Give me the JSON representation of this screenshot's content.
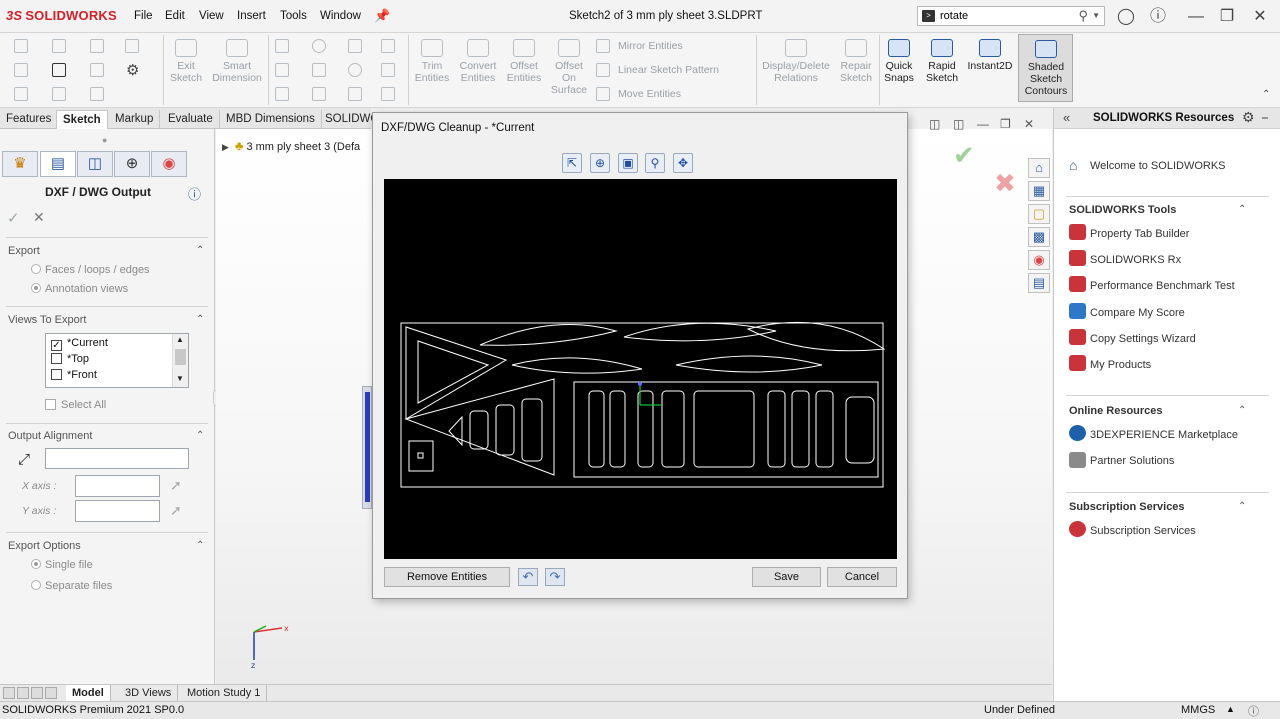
{
  "app": {
    "logo": "SOLIDWORKS",
    "doc_title": "Sketch2 of 3 mm ply sheet 3.SLDPRT"
  },
  "menu": [
    "File",
    "Edit",
    "View",
    "Insert",
    "Tools",
    "Window"
  ],
  "search": {
    "value": "rotate"
  },
  "ribbon": {
    "exit_sketch": "Exit Sketch",
    "smart_dimension": "Smart Dimension",
    "trim_entities": "Trim Entities",
    "convert_entities": "Convert Entities",
    "offset_entities": "Offset Entities",
    "offset_on_surface": "Offset On Surface",
    "mirror_entities": "Mirror Entities",
    "linear_sketch_pattern": "Linear Sketch Pattern",
    "move_entities": "Move Entities",
    "display_delete_relations": "Display/Delete Relations",
    "repair_sketch": "Repair Sketch",
    "quick_snaps": "Quick Snaps",
    "rapid_sketch": "Rapid Sketch",
    "instant2d": "Instant2D",
    "shaded_sketch_contours": "Shaded Sketch Contours"
  },
  "tabs": [
    "Features",
    "Sketch",
    "Markup",
    "Evaluate",
    "MBD Dimensions",
    "SOLIDWO"
  ],
  "tree_item": "3 mm ply sheet 3  (Defa",
  "property_manager": {
    "title": "DXF / DWG Output",
    "export": {
      "heading": "Export",
      "options": [
        "Faces / loops / edges",
        "Annotation views"
      ]
    },
    "views_to_export": {
      "heading": "Views To Export",
      "items": [
        "*Current",
        "*Top",
        "*Front"
      ],
      "select_all": "Select All"
    },
    "output_alignment": {
      "heading": "Output Alignment",
      "x_axis": "X axis :",
      "y_axis": "Y axis :"
    },
    "export_options": {
      "heading": "Export Options",
      "options": [
        "Single file",
        "Separate files"
      ]
    }
  },
  "dialog": {
    "title": "DXF/DWG Cleanup - *Current",
    "remove_entities": "Remove Entities",
    "save": "Save",
    "cancel": "Cancel"
  },
  "resources": {
    "title": "SOLIDWORKS Resources",
    "welcome": "Welcome to SOLIDWORKS",
    "tools_heading": "SOLIDWORKS Tools",
    "tools": [
      "Property Tab Builder",
      "SOLIDWORKS Rx",
      "Performance Benchmark Test",
      "Compare My Score",
      "Copy Settings Wizard",
      "My Products"
    ],
    "online_heading": "Online Resources",
    "online": [
      "3DEXPERIENCE Marketplace",
      "Partner Solutions"
    ],
    "subscription_heading": "Subscription Services",
    "subscription": [
      "Subscription Services"
    ]
  },
  "bottom_tabs": [
    "Model",
    "3D Views",
    "Motion Study 1"
  ],
  "status": {
    "version": "SOLIDWORKS Premium 2021 SP0.0",
    "state": "Under Defined",
    "units": "MMGS"
  },
  "colors": {
    "brand_red": "#d1222a",
    "accent_blue": "#2c5aa0",
    "canvas_bg": "#000000"
  }
}
